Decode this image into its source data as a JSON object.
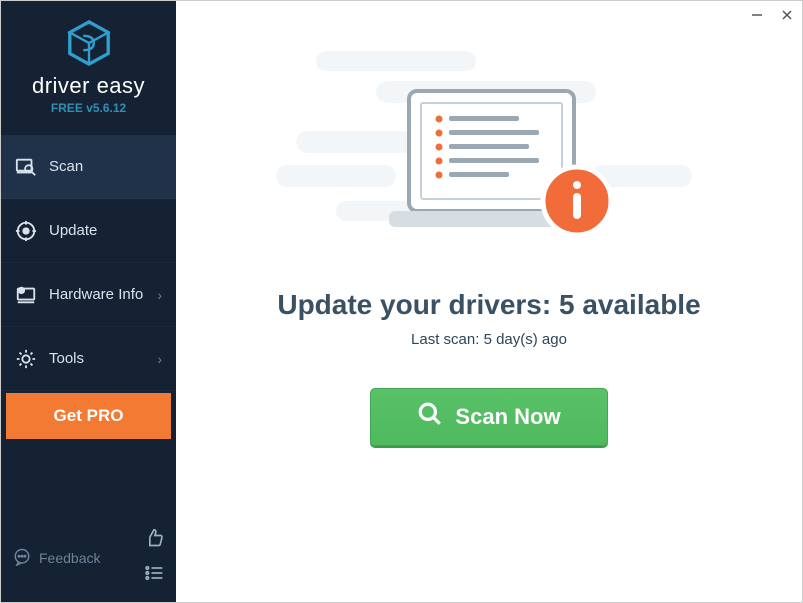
{
  "brand": {
    "name": "driver easy",
    "version": "FREE v5.6.12"
  },
  "sidebar": {
    "items": [
      {
        "label": "Scan",
        "icon": "scan-icon",
        "submenu": false,
        "active": true
      },
      {
        "label": "Update",
        "icon": "update-icon",
        "submenu": false,
        "active": false
      },
      {
        "label": "Hardware Info",
        "icon": "hardware-info-icon",
        "submenu": true,
        "active": false
      },
      {
        "label": "Tools",
        "icon": "tools-icon",
        "submenu": true,
        "active": false
      }
    ],
    "get_pro_label": "Get PRO",
    "feedback_label": "Feedback"
  },
  "main": {
    "headline_prefix": "Update your drivers: ",
    "available_count": 5,
    "headline_suffix": " available",
    "last_scan_prefix": "Last scan: ",
    "last_scan_value": "5 day(s) ago",
    "scan_button_label": "Scan Now"
  },
  "colors": {
    "sidebar_bg": "#142233",
    "accent_orange": "#f37a32",
    "scan_green": "#4fb95e",
    "brand_blue": "#2f8fb5"
  }
}
